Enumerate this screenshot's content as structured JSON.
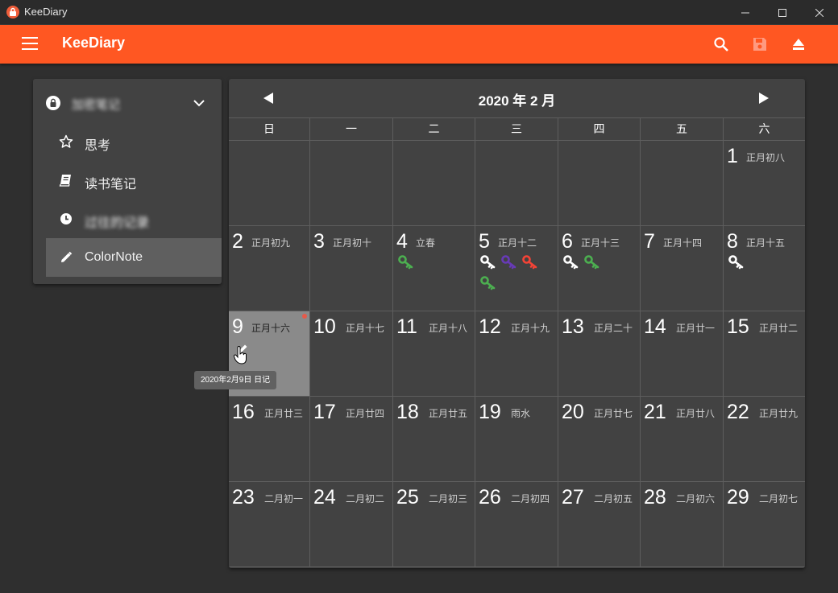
{
  "window": {
    "title": "KeeDiary"
  },
  "appbar": {
    "title": "KeeDiary",
    "icons": [
      "menu-icon",
      "search-icon",
      "save-icon",
      "eject-icon"
    ]
  },
  "sidebar": {
    "database_name": "加密笔记",
    "items": [
      {
        "label": "思考",
        "icon": "star-icon"
      },
      {
        "label": "读书笔记",
        "icon": "book-icon"
      },
      {
        "label": "过往的记录",
        "icon": "clock-icon"
      },
      {
        "label": "ColorNote",
        "icon": "pencil-icon",
        "active": true
      }
    ]
  },
  "calendar": {
    "month_label": "2020 年 2 月",
    "weekdays": [
      "日",
      "一",
      "二",
      "三",
      "四",
      "五",
      "六"
    ],
    "days": [
      {
        "day": "1",
        "lunar": "正月初八",
        "col": 6,
        "row": 0
      },
      {
        "day": "2",
        "lunar": "正月初九",
        "col": 0,
        "row": 1
      },
      {
        "day": "3",
        "lunar": "正月初十",
        "col": 1,
        "row": 1
      },
      {
        "day": "4",
        "lunar": "立春",
        "col": 2,
        "row": 1,
        "keys": [
          "#4caf50"
        ]
      },
      {
        "day": "5",
        "lunar": "正月十二",
        "col": 3,
        "row": 1,
        "keys": [
          "#ffffff",
          "#673ab7",
          "#f44336",
          "#4caf50"
        ]
      },
      {
        "day": "6",
        "lunar": "正月十三",
        "col": 4,
        "row": 1,
        "keys": [
          "#ffffff",
          "#4caf50"
        ]
      },
      {
        "day": "7",
        "lunar": "正月十四",
        "col": 5,
        "row": 1
      },
      {
        "day": "8",
        "lunar": "正月十五",
        "col": 6,
        "row": 1,
        "keys": [
          "#ffffff"
        ]
      },
      {
        "day": "9",
        "lunar": "正月十六",
        "col": 0,
        "row": 2,
        "selected": true,
        "pencil": true
      },
      {
        "day": "10",
        "lunar": "正月十七",
        "col": 1,
        "row": 2
      },
      {
        "day": "11",
        "lunar": "正月十八",
        "col": 2,
        "row": 2
      },
      {
        "day": "12",
        "lunar": "正月十九",
        "col": 3,
        "row": 2
      },
      {
        "day": "13",
        "lunar": "正月二十",
        "col": 4,
        "row": 2
      },
      {
        "day": "14",
        "lunar": "正月廿一",
        "col": 5,
        "row": 2
      },
      {
        "day": "15",
        "lunar": "正月廿二",
        "col": 6,
        "row": 2
      },
      {
        "day": "16",
        "lunar": "正月廿三",
        "col": 0,
        "row": 3
      },
      {
        "day": "17",
        "lunar": "正月廿四",
        "col": 1,
        "row": 3
      },
      {
        "day": "18",
        "lunar": "正月廿五",
        "col": 2,
        "row": 3
      },
      {
        "day": "19",
        "lunar": "雨水",
        "col": 3,
        "row": 3
      },
      {
        "day": "20",
        "lunar": "正月廿七",
        "col": 4,
        "row": 3
      },
      {
        "day": "21",
        "lunar": "正月廿八",
        "col": 5,
        "row": 3
      },
      {
        "day": "22",
        "lunar": "正月廿九",
        "col": 6,
        "row": 3
      },
      {
        "day": "23",
        "lunar": "二月初一",
        "col": 0,
        "row": 4
      },
      {
        "day": "24",
        "lunar": "二月初二",
        "col": 1,
        "row": 4
      },
      {
        "day": "25",
        "lunar": "二月初三",
        "col": 2,
        "row": 4
      },
      {
        "day": "26",
        "lunar": "二月初四",
        "col": 3,
        "row": 4
      },
      {
        "day": "27",
        "lunar": "二月初五",
        "col": 4,
        "row": 4
      },
      {
        "day": "28",
        "lunar": "二月初六",
        "col": 5,
        "row": 4
      },
      {
        "day": "29",
        "lunar": "二月初七",
        "col": 6,
        "row": 4
      }
    ],
    "tooltip": "2020年2月9日 日记"
  },
  "colors": {
    "accent": "#ff5722",
    "selected_cell": "#8a8a8a",
    "panel": "#424242"
  }
}
